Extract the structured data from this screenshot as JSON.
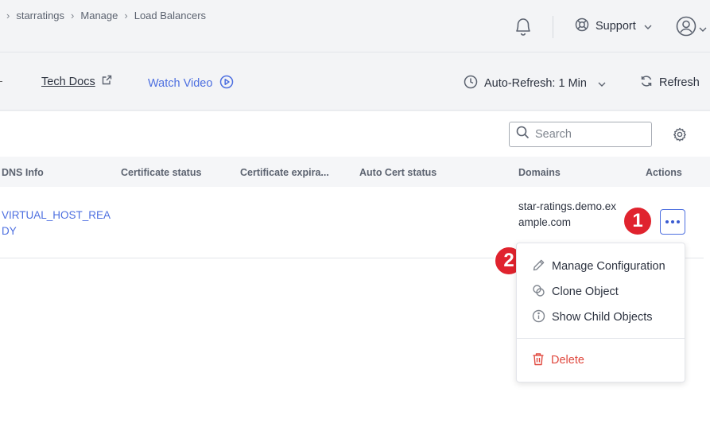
{
  "breadcrumb": {
    "items": [
      "starratings",
      "Manage",
      "Load Balancers"
    ]
  },
  "header": {
    "support_label": "Support"
  },
  "toolbar": {
    "tech_docs_label": "Tech Docs",
    "watch_video_label": "Watch Video",
    "auto_refresh_label": "Auto-Refresh: 1 Min",
    "refresh_label": "Refresh"
  },
  "search": {
    "placeholder": "Search"
  },
  "table": {
    "columns": [
      "DNS Info",
      "Certificate status",
      "Certificate expira...",
      "Auto Cert status",
      "Domains",
      "Actions"
    ],
    "rows": [
      {
        "dns_info": "VIRTUAL_HOST_READY",
        "certificate_status": "",
        "certificate_expiration": "",
        "auto_cert_status": "",
        "domains": "star-ratings.demo.example.com"
      }
    ]
  },
  "actions_menu": {
    "items": [
      {
        "label": "Manage Configuration",
        "icon": "pencil-icon"
      },
      {
        "label": "Clone Object",
        "icon": "clone-icon"
      },
      {
        "label": "Show Child Objects",
        "icon": "info-icon"
      }
    ],
    "delete_label": "Delete",
    "delete_icon": "trash-icon"
  },
  "annotations": {
    "badge_1": "1",
    "badge_2": "2"
  },
  "colors": {
    "accent": "#4d6fe0",
    "danger": "#e0493f",
    "badge": "#e0232e",
    "text": "#2d3340",
    "muted": "#5c6370"
  }
}
